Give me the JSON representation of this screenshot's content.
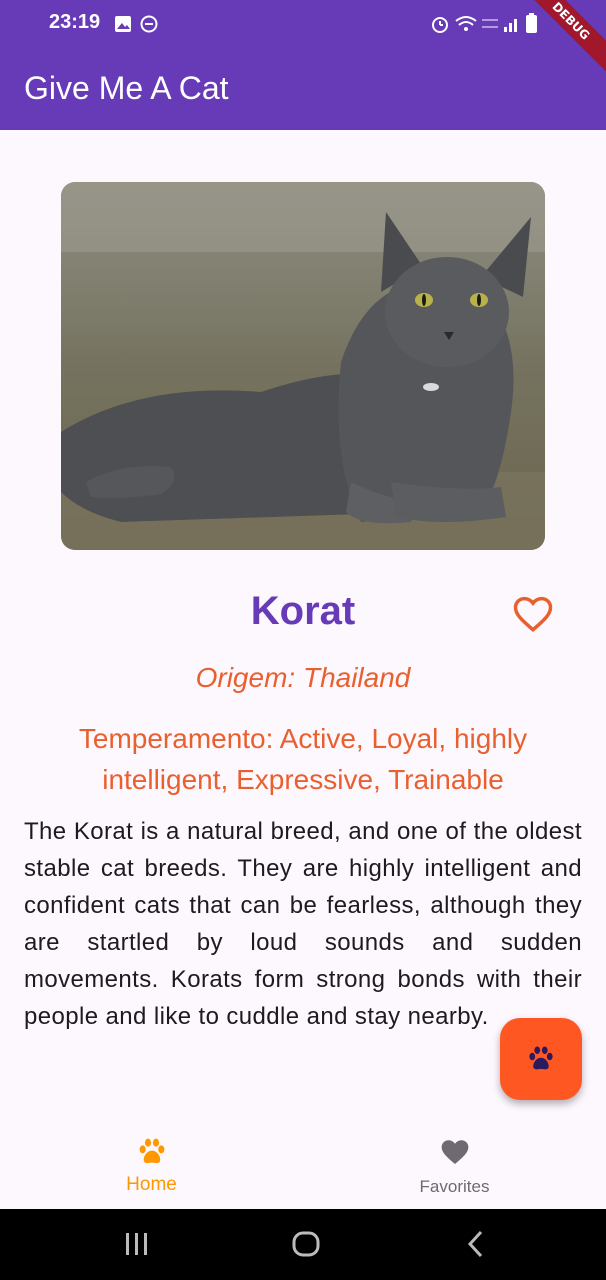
{
  "status_bar": {
    "time": "23:19",
    "debug_banner": "DEBUG"
  },
  "app_bar": {
    "title": "Give Me A Cat"
  },
  "breed": {
    "name": "Korat",
    "origin": "Origem: Thailand",
    "temperament": "Temperamento: Active, Loyal, highly intelligent, Expressive, Trainable",
    "description": "The Korat is a natural breed, and one of the oldest stable cat breeds. They are highly intelligent and confident cats that can be fearless, although they are startled by loud sounds and sudden movements. Korats form strong bonds with their people and like to cuddle and stay nearby."
  },
  "bottom_nav": {
    "items": [
      {
        "label": "Home",
        "icon": "paw-icon",
        "selected": true
      },
      {
        "label": "Favorites",
        "icon": "heart-icon",
        "selected": false
      }
    ]
  },
  "colors": {
    "primary": "#673AB7",
    "accent": "#E9602F",
    "fab": "#FF5722",
    "selected_nav": "#FF9800"
  }
}
